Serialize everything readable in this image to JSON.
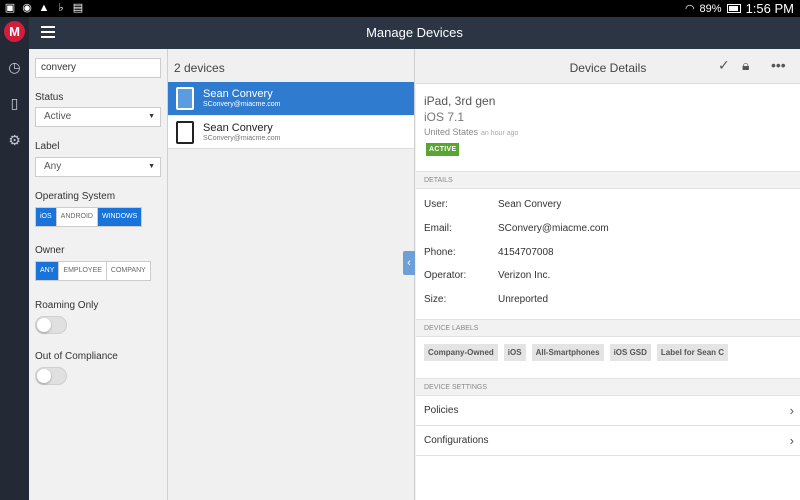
{
  "status_bar": {
    "battery": "89%",
    "time": "1:56 PM",
    "left_icons": [
      "image-icon",
      "signal-icon",
      "warning-icon",
      "b-icon",
      "bag-icon"
    ]
  },
  "app": {
    "title": "Manage Devices",
    "logo_glyph": "M",
    "accent_color": "#2e7bd0"
  },
  "filters": {
    "search_value": "convery",
    "status_label": "Status",
    "status_value": "Active",
    "label_label": "Label",
    "label_value": "Any",
    "os_label": "Operating System",
    "os_options": [
      "iOS",
      "ANDROID",
      "WINDOWS"
    ],
    "owner_label": "Owner",
    "owner_options": [
      "ANY",
      "EMPLOYEE",
      "COMPANY"
    ],
    "roaming_label": "Roaming Only",
    "compliance_label": "Out of Compliance"
  },
  "list": {
    "count": "2 devices",
    "devices": [
      {
        "name": "Sean Convery",
        "email": "SConvery@miacme.com"
      },
      {
        "name": "Sean Convery",
        "email": "SConvery@miacme.com"
      }
    ]
  },
  "details": {
    "title": "Device Details",
    "model": "iPad, 3rd gen",
    "os": "iOS 7.1",
    "country": "United States",
    "last_seen": "an hour ago",
    "status_badge": "ACTIVE",
    "details_header": "DETAILS",
    "fields": [
      {
        "key": "User:",
        "value": "Sean Convery"
      },
      {
        "key": "Email:",
        "value": "SConvery@miacme.com"
      },
      {
        "key": "Phone:",
        "value": "4154707008"
      },
      {
        "key": "Operator:",
        "value": "Verizon Inc."
      },
      {
        "key": "Size:",
        "value": "Unreported"
      }
    ],
    "labels_header": "DEVICE LABELS",
    "labels": [
      "Company-Owned",
      "iOS",
      "All-Smartphones",
      "iOS GSD",
      "Label for Sean C"
    ],
    "settings_header": "DEVICE SETTINGS",
    "settings": [
      "Policies",
      "Configurations"
    ]
  }
}
